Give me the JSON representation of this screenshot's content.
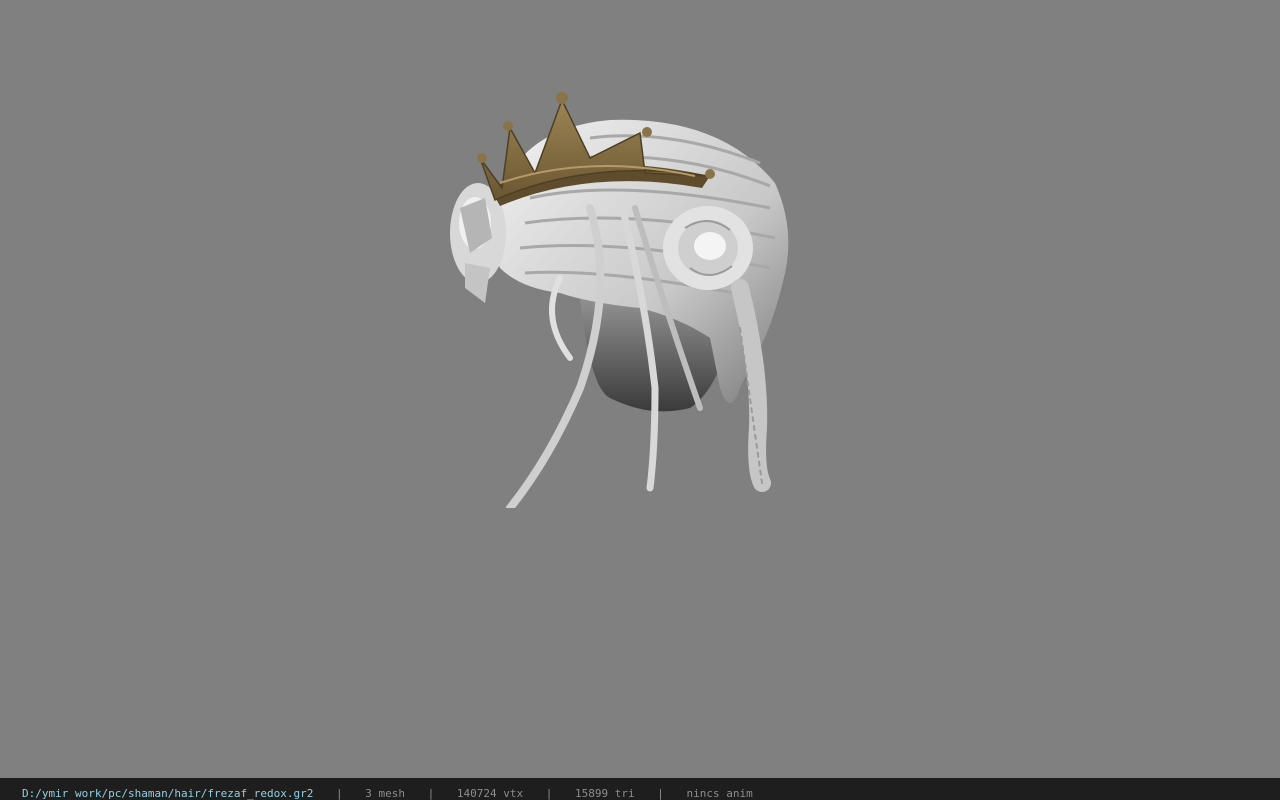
{
  "viewer": {
    "background_color": "#808080",
    "model": {
      "icon": "hair-crown-model",
      "crown_color": "#8a7348",
      "hair_color": "#e6e6e6"
    }
  },
  "status": {
    "file_path": "D:/ymir work/pc/shaman/hair/frezaf_redox.gr2",
    "separator": "|",
    "mesh_count": "3 mesh",
    "vertex_count": "140724 vtx",
    "triangle_count": "15899 tri",
    "anim_status": "nincs anim",
    "path_color": "#8fd0e0",
    "text_color": "#8c8c8c"
  }
}
